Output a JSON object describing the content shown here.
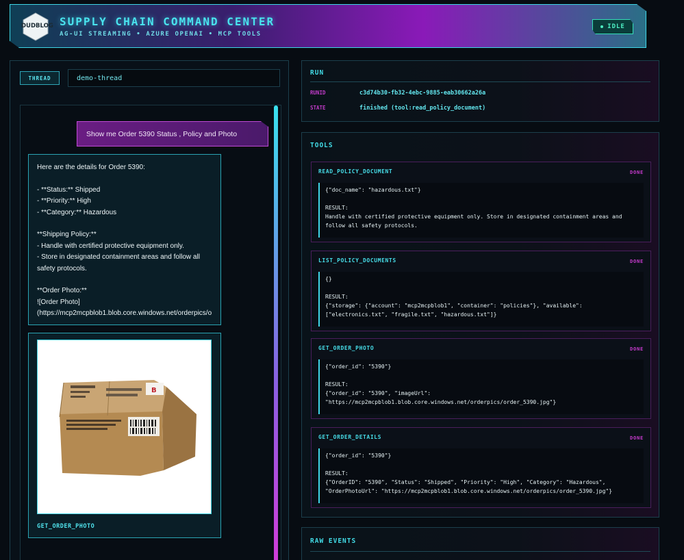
{
  "header": {
    "logo_text": "DUDBLOG",
    "title": "SUPPLY CHAIN COMMAND CENTER",
    "subtitle": "AG-UI STREAMING • AZURE OPENAI • MCP TOOLS",
    "status": "IDLE"
  },
  "thread": {
    "label": "THREAD",
    "value": "demo-thread"
  },
  "chat": {
    "user_message": "Show me Order 5390 Status , Policy and Photo",
    "assistant_message": "Here are the details for Order 5390:\n\n- **Status:** Shipped\n- **Priority:** High\n- **Category:** Hazardous\n\n**Shipping Policy:**\n- Handle with certified protective equipment only.\n- Store in designated containment areas and follow all safety protocols.\n\n**Order Photo:**\n![Order Photo](https://mcp2mcpblob1.blob.core.windows.net/orderpics/o",
    "photo_caption": "GET_ORDER_PHOTO"
  },
  "run": {
    "title": "RUN",
    "runid_label": "RUNID",
    "runid_value": "c3d74b30-fb32-4ebc-9885-eab30662a26a",
    "state_label": "STATE",
    "state_value": "finished (tool:read_policy_document)"
  },
  "tools": {
    "title": "TOOLS",
    "items": [
      {
        "name": "READ_POLICY_DOCUMENT",
        "status": "DONE",
        "body": "{\"doc_name\": \"hazardous.txt\"}\n\nRESULT:\nHandle with certified protective equipment only. Store in designated containment areas and\nfollow all safety protocols."
      },
      {
        "name": "LIST_POLICY_DOCUMENTS",
        "status": "DONE",
        "body": "{}\n\nRESULT:\n{\"storage\": {\"account\": \"mcp2mcpblob1\", \"container\": \"policies\"}, \"available\":\n[\"electronics.txt\", \"fragile.txt\", \"hazardous.txt\"]}"
      },
      {
        "name": "GET_ORDER_PHOTO",
        "status": "DONE",
        "body": "{\"order_id\": \"5390\"}\n\nRESULT:\n{\"order_id\": \"5390\", \"imageUrl\":\n\"https://mcp2mcpblob1.blob.core.windows.net/orderpics/order_5390.jpg\"}"
      },
      {
        "name": "GET_ORDER_DETAILS",
        "status": "DONE",
        "body": "{\"order_id\": \"5390\"}\n\nRESULT:\n{\"OrderID\": \"5390\", \"Status\": \"Shipped\", \"Priority\": \"High\", \"Category\": \"Hazardous\",\n\"OrderPhotoUrl\": \"https://mcp2mcpblob1.blob.core.windows.net/orderpics/order_5390.jpg\"}"
      }
    ]
  },
  "raw_events": {
    "title": "RAW EVENTS"
  },
  "colors": {
    "accent_cyan": "#42dbe6",
    "accent_magenta": "#c93bd0",
    "status_green": "#4df0c4"
  }
}
